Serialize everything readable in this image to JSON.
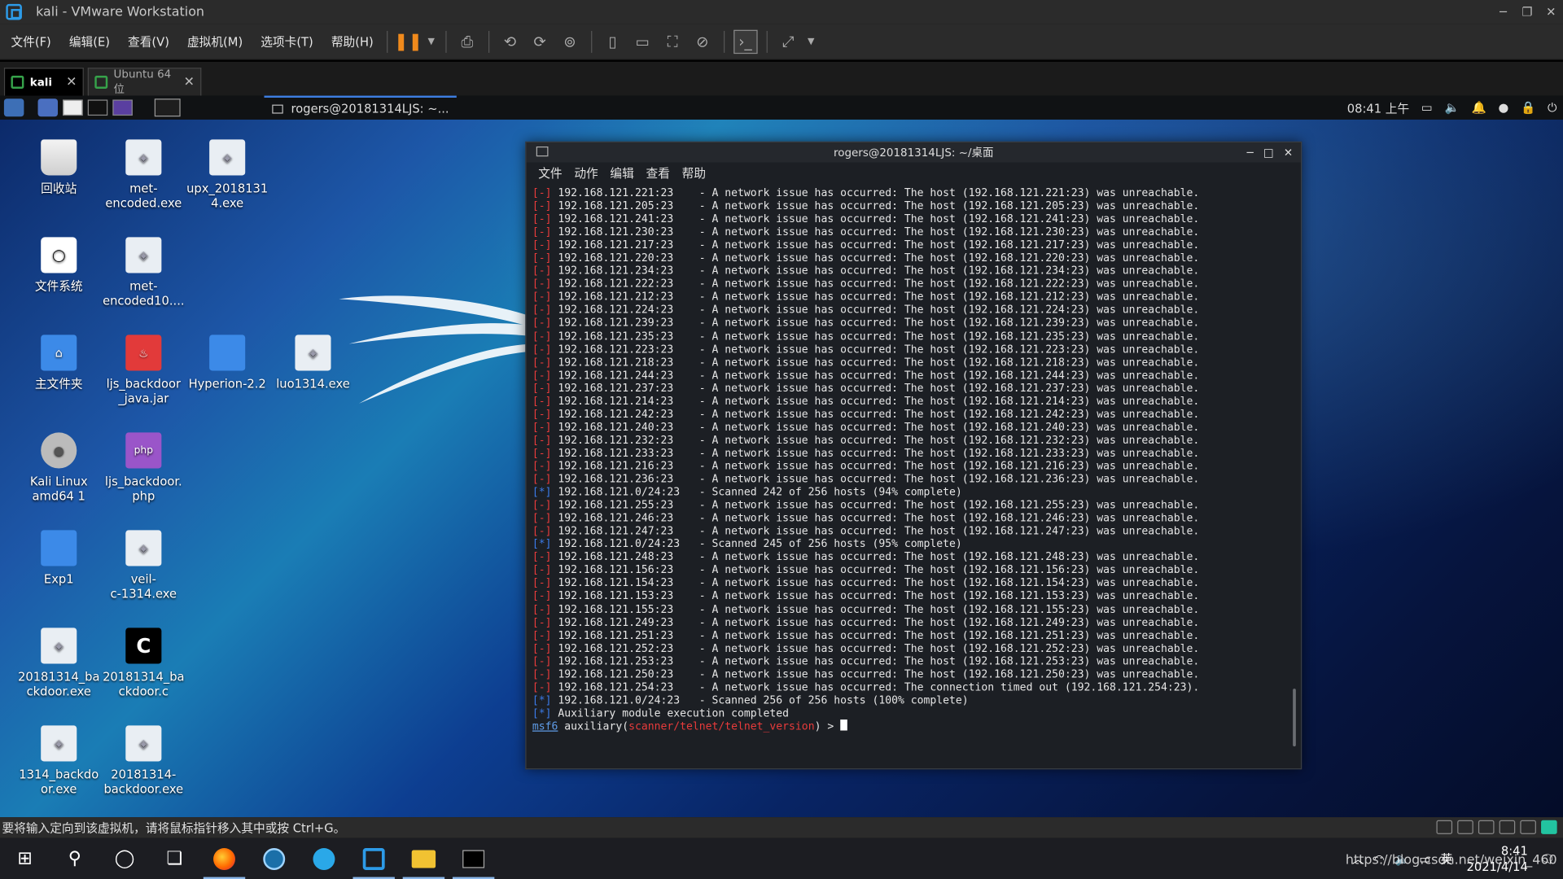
{
  "vmware": {
    "title": "kali - VMware Workstation",
    "menu": [
      "文件(F)",
      "编辑(E)",
      "查看(V)",
      "虚拟机(M)",
      "选项卡(T)",
      "帮助(H)"
    ],
    "tabs": [
      {
        "label": "kali",
        "close": "✕"
      },
      {
        "label": "Ubuntu 64 位",
        "close": "✕"
      }
    ],
    "status_text": "要将输入定向到该虚拟机，请将鼠标指针移入其中或按 Ctrl+G。"
  },
  "kali_panel": {
    "task_label": "rogers@20181314LJS: ~...",
    "time": "08:41 上午"
  },
  "desktop_icons": [
    {
      "label": "回收站",
      "icon": "trash-icon"
    },
    {
      "label": "met-\nencoded.exe",
      "icon": "exe-icon"
    },
    {
      "label": "upx_2018131\n4.exe",
      "icon": "exe-icon"
    },
    {
      "label": "文件系统",
      "icon": "filesystem-icon"
    },
    {
      "label": "met-\nencoded10....",
      "icon": "exe-icon"
    },
    {
      "label": "主文件夹",
      "icon": "home-folder-icon"
    },
    {
      "label": "ljs_backdoor\n_java.jar",
      "icon": "jar-icon"
    },
    {
      "label": "Hyperion-2.2",
      "icon": "folder-icon"
    },
    {
      "label": "luo1314.exe",
      "icon": "exe-icon"
    },
    {
      "label": "Kali Linux\namd64 1",
      "icon": "disc-icon"
    },
    {
      "label": "ljs_backdoor.\nphp",
      "icon": "php-icon"
    },
    {
      "label": "Exp1",
      "icon": "folder-icon"
    },
    {
      "label": "veil-\nc-1314.exe",
      "icon": "exe-icon"
    },
    {
      "label": "20181314_ba\nckdoor.exe",
      "icon": "exe-icon"
    },
    {
      "label": "20181314_ba\nckdoor.c",
      "icon": "c-file-icon"
    },
    {
      "label": "1314_backdo\nor.exe",
      "icon": "exe-icon"
    },
    {
      "label": "20181314-\nbackdoor.exe",
      "icon": "exe-icon"
    }
  ],
  "terminal": {
    "title": "rogers@20181314LJS: ~/桌面",
    "menu": [
      "文件",
      "动作",
      "编辑",
      "查看",
      "帮助"
    ],
    "lines": [
      {
        "p": "[-]",
        "t": " 192.168.121.221:23    - A network issue has occurred: The host (192.168.121.221:23) was unreachable."
      },
      {
        "p": "[-]",
        "t": " 192.168.121.205:23    - A network issue has occurred: The host (192.168.121.205:23) was unreachable."
      },
      {
        "p": "[-]",
        "t": " 192.168.121.241:23    - A network issue has occurred: The host (192.168.121.241:23) was unreachable."
      },
      {
        "p": "[-]",
        "t": " 192.168.121.230:23    - A network issue has occurred: The host (192.168.121.230:23) was unreachable."
      },
      {
        "p": "[-]",
        "t": " 192.168.121.217:23    - A network issue has occurred: The host (192.168.121.217:23) was unreachable."
      },
      {
        "p": "[-]",
        "t": " 192.168.121.220:23    - A network issue has occurred: The host (192.168.121.220:23) was unreachable."
      },
      {
        "p": "[-]",
        "t": " 192.168.121.234:23    - A network issue has occurred: The host (192.168.121.234:23) was unreachable."
      },
      {
        "p": "[-]",
        "t": " 192.168.121.222:23    - A network issue has occurred: The host (192.168.121.222:23) was unreachable."
      },
      {
        "p": "[-]",
        "t": " 192.168.121.212:23    - A network issue has occurred: The host (192.168.121.212:23) was unreachable."
      },
      {
        "p": "[-]",
        "t": " 192.168.121.224:23    - A network issue has occurred: The host (192.168.121.224:23) was unreachable."
      },
      {
        "p": "[-]",
        "t": " 192.168.121.239:23    - A network issue has occurred: The host (192.168.121.239:23) was unreachable."
      },
      {
        "p": "[-]",
        "t": " 192.168.121.235:23    - A network issue has occurred: The host (192.168.121.235:23) was unreachable."
      },
      {
        "p": "[-]",
        "t": " 192.168.121.223:23    - A network issue has occurred: The host (192.168.121.223:23) was unreachable."
      },
      {
        "p": "[-]",
        "t": " 192.168.121.218:23    - A network issue has occurred: The host (192.168.121.218:23) was unreachable."
      },
      {
        "p": "[-]",
        "t": " 192.168.121.244:23    - A network issue has occurred: The host (192.168.121.244:23) was unreachable."
      },
      {
        "p": "[-]",
        "t": " 192.168.121.237:23    - A network issue has occurred: The host (192.168.121.237:23) was unreachable."
      },
      {
        "p": "[-]",
        "t": " 192.168.121.214:23    - A network issue has occurred: The host (192.168.121.214:23) was unreachable."
      },
      {
        "p": "[-]",
        "t": " 192.168.121.242:23    - A network issue has occurred: The host (192.168.121.242:23) was unreachable."
      },
      {
        "p": "[-]",
        "t": " 192.168.121.240:23    - A network issue has occurred: The host (192.168.121.240:23) was unreachable."
      },
      {
        "p": "[-]",
        "t": " 192.168.121.232:23    - A network issue has occurred: The host (192.168.121.232:23) was unreachable."
      },
      {
        "p": "[-]",
        "t": " 192.168.121.233:23    - A network issue has occurred: The host (192.168.121.233:23) was unreachable."
      },
      {
        "p": "[-]",
        "t": " 192.168.121.216:23    - A network issue has occurred: The host (192.168.121.216:23) was unreachable."
      },
      {
        "p": "[-]",
        "t": " 192.168.121.236:23    - A network issue has occurred: The host (192.168.121.236:23) was unreachable."
      },
      {
        "p": "[*]",
        "t": " 192.168.121.0/24:23   - Scanned 242 of 256 hosts (94% complete)"
      },
      {
        "p": "[-]",
        "t": " 192.168.121.255:23    - A network issue has occurred: The host (192.168.121.255:23) was unreachable."
      },
      {
        "p": "[-]",
        "t": " 192.168.121.246:23    - A network issue has occurred: The host (192.168.121.246:23) was unreachable."
      },
      {
        "p": "[-]",
        "t": " 192.168.121.247:23    - A network issue has occurred: The host (192.168.121.247:23) was unreachable."
      },
      {
        "p": "[*]",
        "t": " 192.168.121.0/24:23   - Scanned 245 of 256 hosts (95% complete)"
      },
      {
        "p": "[-]",
        "t": " 192.168.121.248:23    - A network issue has occurred: The host (192.168.121.248:23) was unreachable."
      },
      {
        "p": "[-]",
        "t": " 192.168.121.156:23    - A network issue has occurred: The host (192.168.121.156:23) was unreachable."
      },
      {
        "p": "[-]",
        "t": " 192.168.121.154:23    - A network issue has occurred: The host (192.168.121.154:23) was unreachable."
      },
      {
        "p": "[-]",
        "t": " 192.168.121.153:23    - A network issue has occurred: The host (192.168.121.153:23) was unreachable."
      },
      {
        "p": "[-]",
        "t": " 192.168.121.155:23    - A network issue has occurred: The host (192.168.121.155:23) was unreachable."
      },
      {
        "p": "[-]",
        "t": " 192.168.121.249:23    - A network issue has occurred: The host (192.168.121.249:23) was unreachable."
      },
      {
        "p": "[-]",
        "t": " 192.168.121.251:23    - A network issue has occurred: The host (192.168.121.251:23) was unreachable."
      },
      {
        "p": "[-]",
        "t": " 192.168.121.252:23    - A network issue has occurred: The host (192.168.121.252:23) was unreachable."
      },
      {
        "p": "[-]",
        "t": " 192.168.121.253:23    - A network issue has occurred: The host (192.168.121.253:23) was unreachable."
      },
      {
        "p": "[-]",
        "t": " 192.168.121.250:23    - A network issue has occurred: The host (192.168.121.250:23) was unreachable."
      },
      {
        "p": "[-]",
        "t": " 192.168.121.254:23    - A network issue has occurred: The connection timed out (192.168.121.254:23)."
      },
      {
        "p": "[*]",
        "t": " 192.168.121.0/24:23   - Scanned 256 of 256 hosts (100% complete)"
      },
      {
        "p": "[*]",
        "t": " Auxiliary module execution completed"
      }
    ],
    "prompt": {
      "msf": "msf6",
      "cmd": " auxiliary(",
      "module": "scanner/telnet/telnet_version",
      "end": ") > "
    }
  },
  "taskbar": {
    "apps": [
      "start-icon",
      "search-icon",
      "cortana-icon",
      "task-view-icon",
      "firefox-icon",
      "steam-icon",
      "maxthon-icon",
      "vmware-icon",
      "file-explorer-icon",
      "terminal-icon"
    ],
    "ime": "英",
    "time": "8:41",
    "date": "2021/4/14",
    "watermark": "https://blog.csdn.net/weixin_460"
  },
  "colors": {
    "accent": "#2d9be8",
    "error": "#e83b3b",
    "status": "#3b7be8",
    "pause": "#f08a1c"
  }
}
